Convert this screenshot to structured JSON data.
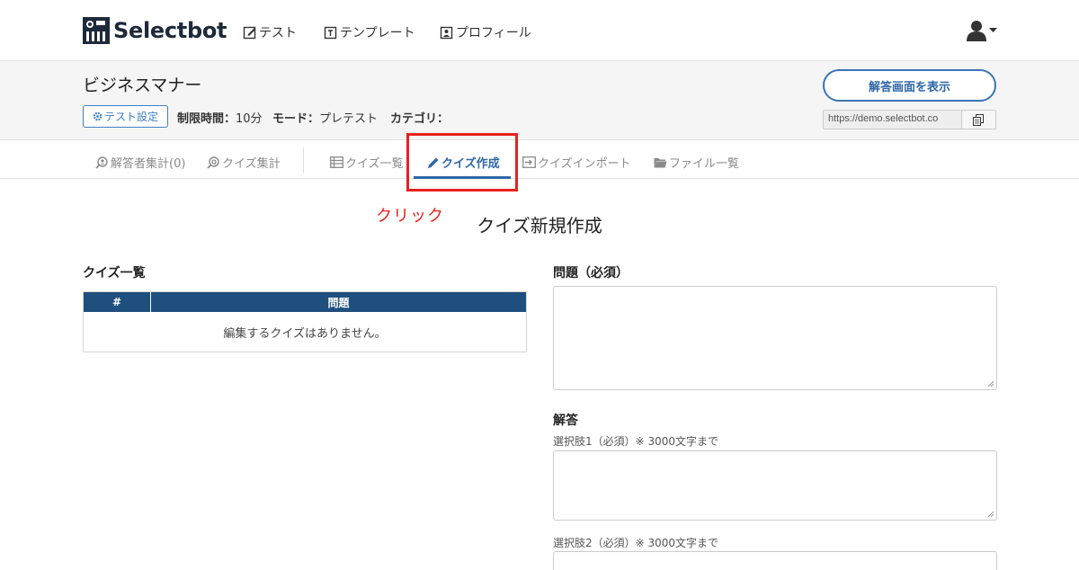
{
  "nav": {
    "logo_text": "Selectbot",
    "links": [
      "テスト",
      "テンプレート",
      "プロフィール"
    ]
  },
  "header": {
    "title": "ビジネスマナー",
    "settings_label": "テスト設定",
    "time_limit_label": "制限時間：",
    "time_limit_value": "10分",
    "mode_label": "モード：",
    "mode_value": "プレテスト",
    "category_label": "カテゴリ：",
    "show_answer_screen": "解答画面を表示",
    "url": "https://demo.selectbot.co"
  },
  "tabs": [
    {
      "label": "解答者集計(0)",
      "icon": "person-search-icon"
    },
    {
      "label": "クイズ集計",
      "icon": "quiz-search-icon"
    },
    {
      "label": "クイズ一覧",
      "icon": "list-icon"
    },
    {
      "label": "クイズ作成",
      "icon": "pencil-icon",
      "active": true
    },
    {
      "label": "クイズインポート",
      "icon": "import-icon"
    },
    {
      "label": "ファイル一覧",
      "icon": "folder-icon"
    }
  ],
  "annotation": {
    "click_label": "クリック",
    "color": "#e8211e"
  },
  "main": {
    "title": "クイズ新規作成",
    "quiz_list_title": "クイズ一覧",
    "table_headers": [
      "#",
      "問題"
    ],
    "empty_message": "編集するクイズはありません。",
    "question_label": "問題（必須）",
    "answers_label": "解答",
    "choice1_label": "選択肢1（必須）※ 3000文字まで",
    "choice2_label": "選択肢2（必須）※ 3000文字まで"
  },
  "colors": {
    "accent": "#2f67a8",
    "table_header": "#1f4f7d",
    "band": "#f5f5f5"
  }
}
